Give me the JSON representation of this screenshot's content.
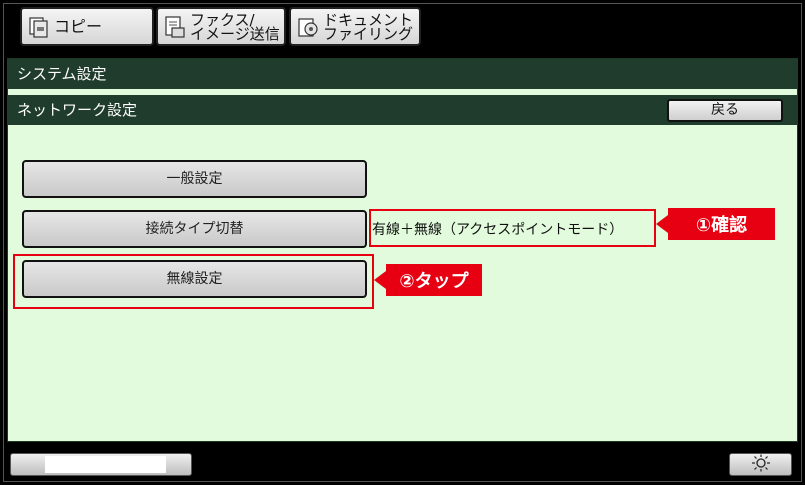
{
  "tabs": [
    {
      "label": "コピー",
      "icon": "copy-icon"
    },
    {
      "label": "ファクス/\nイメージ送信",
      "icon": "fax-icon"
    },
    {
      "label": "ドキュメント\nファイリング",
      "icon": "document-filing-icon"
    }
  ],
  "header": {
    "system_title": "システム設定",
    "network_title": "ネットワーク設定",
    "back_label": "戻る"
  },
  "menu": {
    "general_label": "一般設定",
    "connection_label": "接続タイプ切替",
    "connection_value": "有線＋無線（アクセスポイントモード）",
    "wireless_label": "無線設定"
  },
  "annotations": {
    "confirm_label": "①確認",
    "tap_label": "②タップ",
    "highlight_color": "#e60012"
  },
  "colors": {
    "titlebar": "#203c2c",
    "panel": "#e1fbdc"
  },
  "footer": {
    "brightness_icon": "sun-icon"
  }
}
